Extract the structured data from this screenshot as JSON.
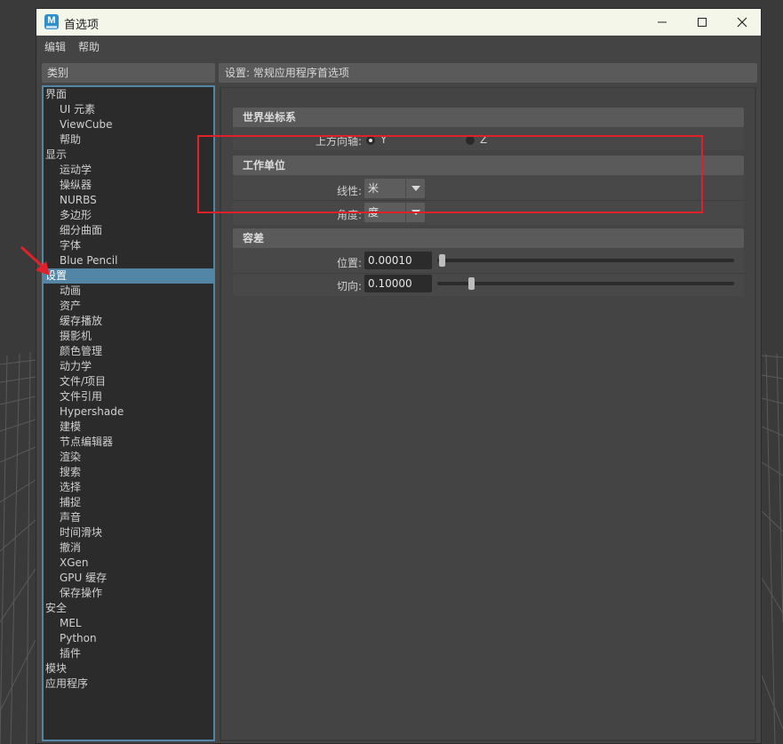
{
  "window": {
    "title": "首选项",
    "icon": "maya-app-icon"
  },
  "menubar": {
    "items": [
      "编辑",
      "帮助"
    ]
  },
  "categories": {
    "header": "类别",
    "items": [
      {
        "label": "界面",
        "level": 0
      },
      {
        "label": "UI 元素",
        "level": 1
      },
      {
        "label": "ViewCube",
        "level": 1
      },
      {
        "label": "帮助",
        "level": 1
      },
      {
        "label": "显示",
        "level": 0
      },
      {
        "label": "运动学",
        "level": 1
      },
      {
        "label": "操纵器",
        "level": 1
      },
      {
        "label": "NURBS",
        "level": 1
      },
      {
        "label": "多边形",
        "level": 1
      },
      {
        "label": "细分曲面",
        "level": 1
      },
      {
        "label": "字体",
        "level": 1
      },
      {
        "label": "Blue Pencil",
        "level": 1
      },
      {
        "label": "设置",
        "level": 0,
        "selected": true
      },
      {
        "label": "动画",
        "level": 1
      },
      {
        "label": "资产",
        "level": 1
      },
      {
        "label": "缓存播放",
        "level": 1
      },
      {
        "label": "摄影机",
        "level": 1
      },
      {
        "label": "颜色管理",
        "level": 1
      },
      {
        "label": "动力学",
        "level": 1
      },
      {
        "label": "文件/项目",
        "level": 1
      },
      {
        "label": "文件引用",
        "level": 1
      },
      {
        "label": "Hypershade",
        "level": 1
      },
      {
        "label": "建模",
        "level": 1
      },
      {
        "label": "节点编辑器",
        "level": 1
      },
      {
        "label": "渲染",
        "level": 1
      },
      {
        "label": "搜索",
        "level": 1
      },
      {
        "label": "选择",
        "level": 1
      },
      {
        "label": "捕捉",
        "level": 1
      },
      {
        "label": "声音",
        "level": 1
      },
      {
        "label": "时间滑块",
        "level": 1
      },
      {
        "label": "撤消",
        "level": 1
      },
      {
        "label": "XGen",
        "level": 1
      },
      {
        "label": "GPU 缓存",
        "level": 1
      },
      {
        "label": "保存操作",
        "level": 1
      },
      {
        "label": "安全",
        "level": 0
      },
      {
        "label": "MEL",
        "level": 1
      },
      {
        "label": "Python",
        "level": 1
      },
      {
        "label": "插件",
        "level": 1
      },
      {
        "label": "模块",
        "level": 0
      },
      {
        "label": "应用程序",
        "level": 0
      }
    ]
  },
  "settings": {
    "header": "设置: 常规应用程序首选项",
    "world_coords": {
      "title": "世界坐标系",
      "up_axis_label": "上方向轴:",
      "options": [
        {
          "label": "Y",
          "selected": true
        },
        {
          "label": "Z",
          "selected": false
        }
      ]
    },
    "working_units": {
      "title": "工作单位",
      "linear_label": "线性:",
      "linear_value": "米",
      "angular_label": "角度:",
      "angular_value": "度"
    },
    "tolerance": {
      "title": "容差",
      "position_label": "位置:",
      "position_value": "0.00010",
      "position_slider": 0.0,
      "tangent_label": "切向:",
      "tangent_value": "0.10000",
      "tangent_slider": 0.1
    }
  },
  "colors": {
    "selection": "#5285a6",
    "highlight_box": "#e0202a",
    "annotation_arrow": "#e0202a"
  }
}
